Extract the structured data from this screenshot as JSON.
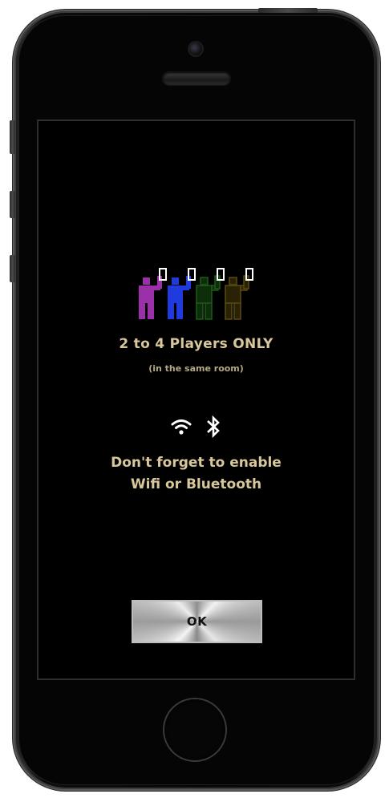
{
  "colors": {
    "text_primary": "#d7c79a",
    "text_secondary": "#b4a784",
    "player1": "#9b30a8",
    "player2": "#1f3be0",
    "player3": "#1c5a17",
    "player4": "#5a4a10"
  },
  "dialog": {
    "players_title": "2 to 4 Players ONLY",
    "players_subtitle": "(in the same room)",
    "reminder_line1": "Don't forget to enable",
    "reminder_line2": "Wifi or Bluetooth",
    "ok_label": "OK"
  },
  "icons": {
    "players": "players-holding-phones-icon",
    "wifi": "wifi-icon",
    "bluetooth": "bluetooth-icon"
  }
}
